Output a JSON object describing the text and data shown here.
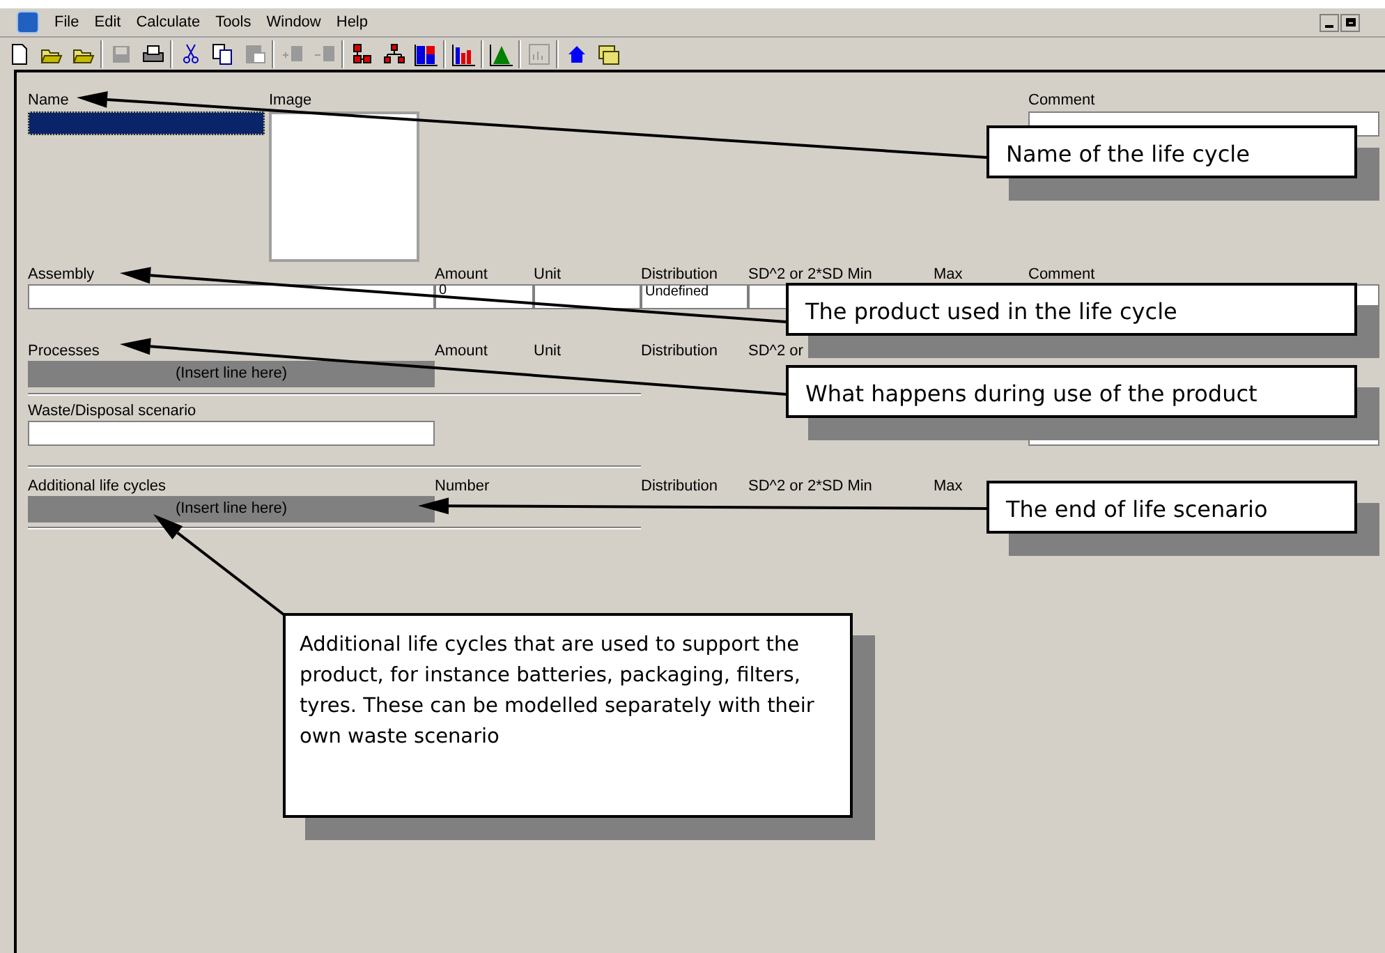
{
  "menu": [
    "File",
    "Edit",
    "Calculate",
    "Tools",
    "Window",
    "Help"
  ],
  "toolbar": [
    {
      "kind": "new",
      "disabled": false
    },
    {
      "kind": "open",
      "disabled": false
    },
    {
      "kind": "open",
      "disabled": false
    },
    {
      "kind": "sep"
    },
    {
      "kind": "save",
      "disabled": true
    },
    {
      "kind": "print",
      "disabled": false
    },
    {
      "kind": "sep"
    },
    {
      "kind": "cut",
      "disabled": false
    },
    {
      "kind": "copy",
      "disabled": false
    },
    {
      "kind": "paste",
      "disabled": true
    },
    {
      "kind": "sep"
    },
    {
      "kind": "add-rows",
      "disabled": true
    },
    {
      "kind": "remove-rows",
      "disabled": true
    },
    {
      "kind": "sep"
    },
    {
      "kind": "network",
      "disabled": false
    },
    {
      "kind": "tree",
      "disabled": false
    },
    {
      "kind": "stacked",
      "disabled": false
    },
    {
      "kind": "sep"
    },
    {
      "kind": "bars",
      "disabled": false
    },
    {
      "kind": "sep"
    },
    {
      "kind": "peak",
      "disabled": false
    },
    {
      "kind": "sep"
    },
    {
      "kind": "chart",
      "disabled": true
    },
    {
      "kind": "sep"
    },
    {
      "kind": "home",
      "disabled": false
    },
    {
      "kind": "folders",
      "disabled": false
    }
  ],
  "top": {
    "name_label": "Name",
    "name_selected": true,
    "image_label": "Image",
    "comment_label": "Comment"
  },
  "assembly": {
    "headers": {
      "name": "Assembly",
      "amount": "Amount",
      "unit": "Unit",
      "distribution": "Distribution",
      "sd": "SD^2 or 2*SD Min",
      "max": "Max",
      "comment": "Comment"
    },
    "amount": "0",
    "distribution": "Undefined"
  },
  "processes": {
    "headers": {
      "name": "Processes",
      "amount": "Amount",
      "unit": "Unit",
      "distribution": "Distribution",
      "sd": "SD^2 or"
    },
    "insert": "(Insert line here)"
  },
  "waste": {
    "label": "Waste/Disposal scenario"
  },
  "additional": {
    "headers": {
      "name": "Additional life cycles",
      "amount": "Number",
      "distribution": "Distribution",
      "sd": "SD^2 or 2*SD Min",
      "max": "Max"
    },
    "insert": "(Insert line here)"
  },
  "callouts": [
    {
      "text": "Name of the life cycle"
    },
    {
      "text": "The product used in the life cycle"
    },
    {
      "text": "What happens during use of the product"
    },
    {
      "text": "The end of life scenario"
    },
    {
      "text": "Additional life cycles that are used to support the product, for instance batteries, packaging, filters, tyres. These can be modelled separately with their own waste scenario"
    }
  ]
}
